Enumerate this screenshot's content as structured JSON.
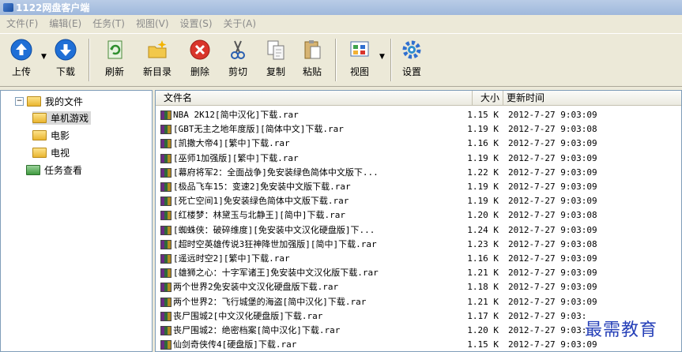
{
  "window": {
    "title": "1122网盘客户端"
  },
  "menu": [
    "文件(F)",
    "编辑(E)",
    "任务(T)",
    "视图(V)",
    "设置(S)",
    "关于(A)"
  ],
  "toolbar": {
    "upload": "上传",
    "download": "下载",
    "refresh": "刷新",
    "new_folder": "新目录",
    "delete": "删除",
    "cut": "剪切",
    "copy": "复制",
    "paste": "粘贴",
    "view": "视图",
    "settings": "设置"
  },
  "tree": {
    "root": "我的文件",
    "children": [
      "单机游戏",
      "电影",
      "电视"
    ],
    "tasks": "任务查看"
  },
  "list": {
    "headers": {
      "name": "文件名",
      "size": "大小",
      "time": "更新时间"
    },
    "rows": [
      {
        "name": "NBA 2K12[简中汉化]下载.rar",
        "size": "1.15 K",
        "time": "2012-7-27 9:03:09"
      },
      {
        "name": "[GBT无主之地年度版][简体中文]下载.rar",
        "size": "1.19 K",
        "time": "2012-7-27 9:03:08"
      },
      {
        "name": "[凯撒大帝4][繁中]下载.rar",
        "size": "1.16 K",
        "time": "2012-7-27 9:03:09"
      },
      {
        "name": "[巫师1加强版][繁中]下载.rar",
        "size": "1.19 K",
        "time": "2012-7-27 9:03:09"
      },
      {
        "name": "[幕府将军2：全面战争]免安装绿色简体中文版下...",
        "size": "1.22 K",
        "time": "2012-7-27 9:03:09"
      },
      {
        "name": "[极品飞车15：变速2]免安装中文版下载.rar",
        "size": "1.19 K",
        "time": "2012-7-27 9:03:09"
      },
      {
        "name": "[死亡空间1]免安装绿色简体中文版下载.rar",
        "size": "1.19 K",
        "time": "2012-7-27 9:03:09"
      },
      {
        "name": "[红楼梦：林黛玉与北静王][简中]下载.rar",
        "size": "1.20 K",
        "time": "2012-7-27 9:03:08"
      },
      {
        "name": "[蜘蛛侠：破碎维度][免安装中文汉化硬盘版]下...",
        "size": "1.24 K",
        "time": "2012-7-27 9:03:09"
      },
      {
        "name": "[超时空英雄传说3狂神降世加强版][简中]下载.rar",
        "size": "1.23 K",
        "time": "2012-7-27 9:03:08"
      },
      {
        "name": "[遥远时空2][繁中]下载.rar",
        "size": "1.16 K",
        "time": "2012-7-27 9:03:09"
      },
      {
        "name": "[雄狮之心：十字军诸王]免安装中文汉化版下载.rar",
        "size": "1.21 K",
        "time": "2012-7-27 9:03:09"
      },
      {
        "name": "两个世界2免安装中文汉化硬盘版下载.rar",
        "size": "1.18 K",
        "time": "2012-7-27 9:03:09"
      },
      {
        "name": "两个世界2：飞行城堡的海盗[简中汉化]下载.rar",
        "size": "1.21 K",
        "time": "2012-7-27 9:03:09"
      },
      {
        "name": "丧尸围城2[中文汉化硬盘版]下载.rar",
        "size": "1.17 K",
        "time": "2012-7-27 9:03:"
      },
      {
        "name": "丧尸围城2：绝密档案[简中汉化]下载.rar",
        "size": "1.20 K",
        "time": "2012-7-27 9:03:"
      },
      {
        "name": "仙剑奇侠传4[硬盘版]下载.rar",
        "size": "1.15 K",
        "time": "2012-7-27 9:03:09"
      }
    ]
  },
  "watermark": "最需教育"
}
